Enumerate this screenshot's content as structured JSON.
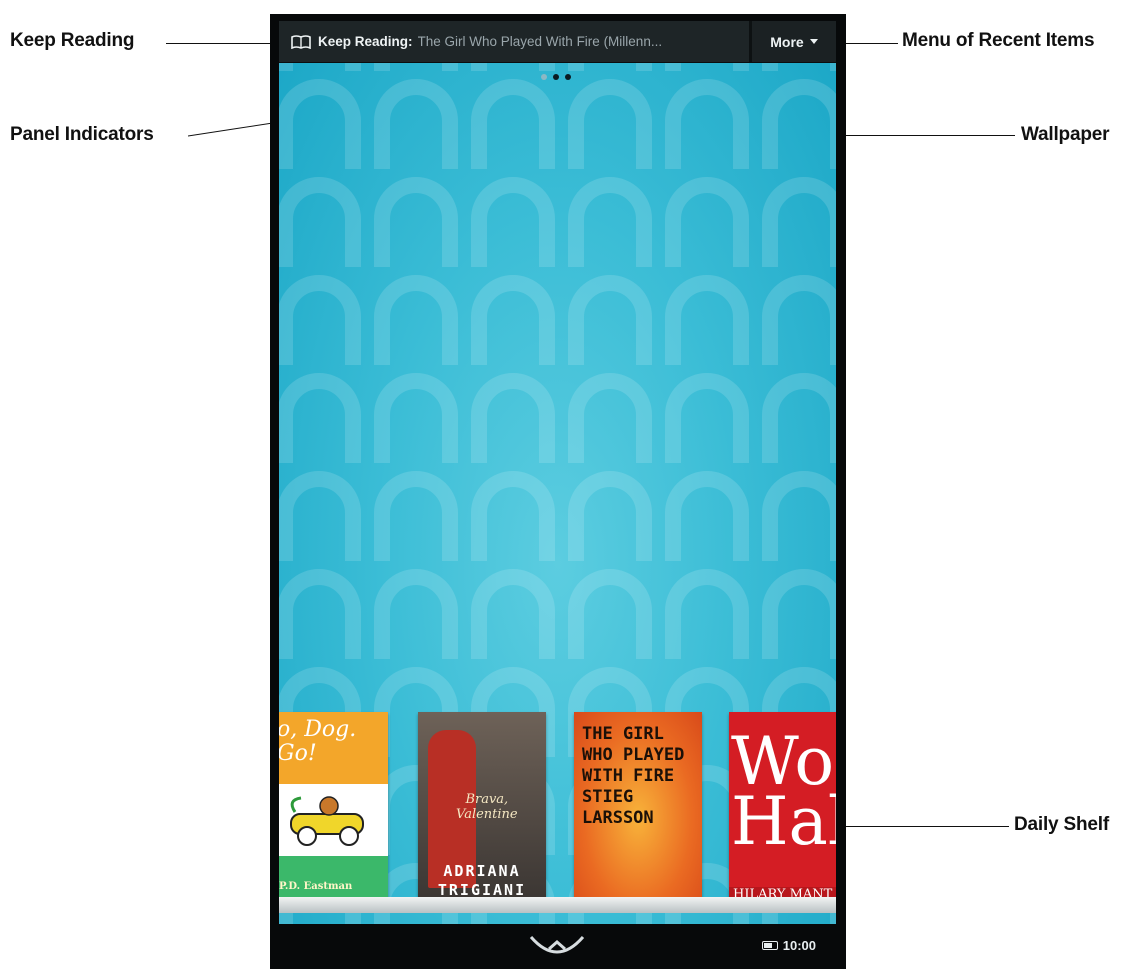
{
  "callouts": {
    "keep_reading": "Keep Reading",
    "panel_indicators": "Panel Indicators",
    "menu_recent": "Menu of Recent Items",
    "wallpaper": "Wallpaper",
    "daily_shelf": "Daily Shelf"
  },
  "topbar": {
    "keep_reading_label": "Keep Reading:",
    "keep_reading_title": "The Girl Who Played With Fire (Millenn...",
    "more_label": "More"
  },
  "panel_indicators": {
    "count": 3,
    "active_index": 0
  },
  "shelf": {
    "books": [
      {
        "title_lines": [
          "o, Dog.",
          "Go!"
        ],
        "author": "P.D. Eastman"
      },
      {
        "title_lines": [
          "Brava,",
          "Valentine"
        ],
        "author_lines": [
          "ADRIANA",
          "TRIGIANI"
        ]
      },
      {
        "title_lines": [
          "THE GIRL",
          "WHO PLAYED",
          "WITH FIRE",
          "STIEG LARSSON"
        ]
      },
      {
        "title_lines": [
          "Wol",
          "Hal"
        ],
        "author": "HILARY MANT"
      }
    ]
  },
  "statusbar": {
    "time": "10:00"
  },
  "colors": {
    "accent": "#1aa6c6",
    "topbar": "#1e2527",
    "background": "#07090a"
  }
}
